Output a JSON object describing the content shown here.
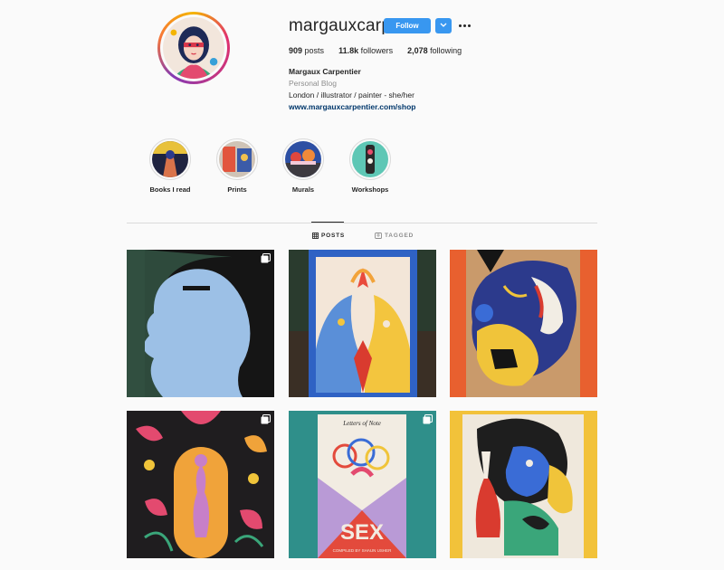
{
  "profile": {
    "username": "margauxcarpe",
    "follow_label": "Follow",
    "more_icon": "more-horizontal-icon",
    "stats": [
      {
        "count": "909",
        "label": "posts"
      },
      {
        "count": "11.8k",
        "label": "followers"
      },
      {
        "count": "2,078",
        "label": "following"
      }
    ],
    "full_name": "Margaux Carpentier",
    "category": "Personal Blog",
    "bio": "London / illustrator / painter - she/her",
    "website": "www.margauxcarpentier.com/shop"
  },
  "highlights": [
    {
      "label": "Books I read"
    },
    {
      "label": "Prints"
    },
    {
      "label": "Murals"
    },
    {
      "label": "Workshops"
    }
  ],
  "tabs": [
    {
      "label": "POSTS",
      "icon": "grid-icon",
      "active": true
    },
    {
      "label": "TAGGED",
      "icon": "tag-icon",
      "active": false
    }
  ],
  "colors": {
    "accent": "#3897f0",
    "link": "#00376b",
    "muted": "#8e8e8e"
  },
  "posts": [
    {
      "name": "blue-profile-mural",
      "multi": true
    },
    {
      "name": "two-faces-window",
      "multi": false
    },
    {
      "name": "abstract-face-painting",
      "multi": false
    },
    {
      "name": "floral-figure-illustration",
      "multi": true
    },
    {
      "name": "sex-book-cover",
      "multi": true
    },
    {
      "name": "colorful-figure-painting",
      "multi": false
    }
  ],
  "book_cover": {
    "title": "SEX",
    "subtitle": "Letters of Note",
    "compiled": "COMPILED BY SHAUN USHER"
  }
}
